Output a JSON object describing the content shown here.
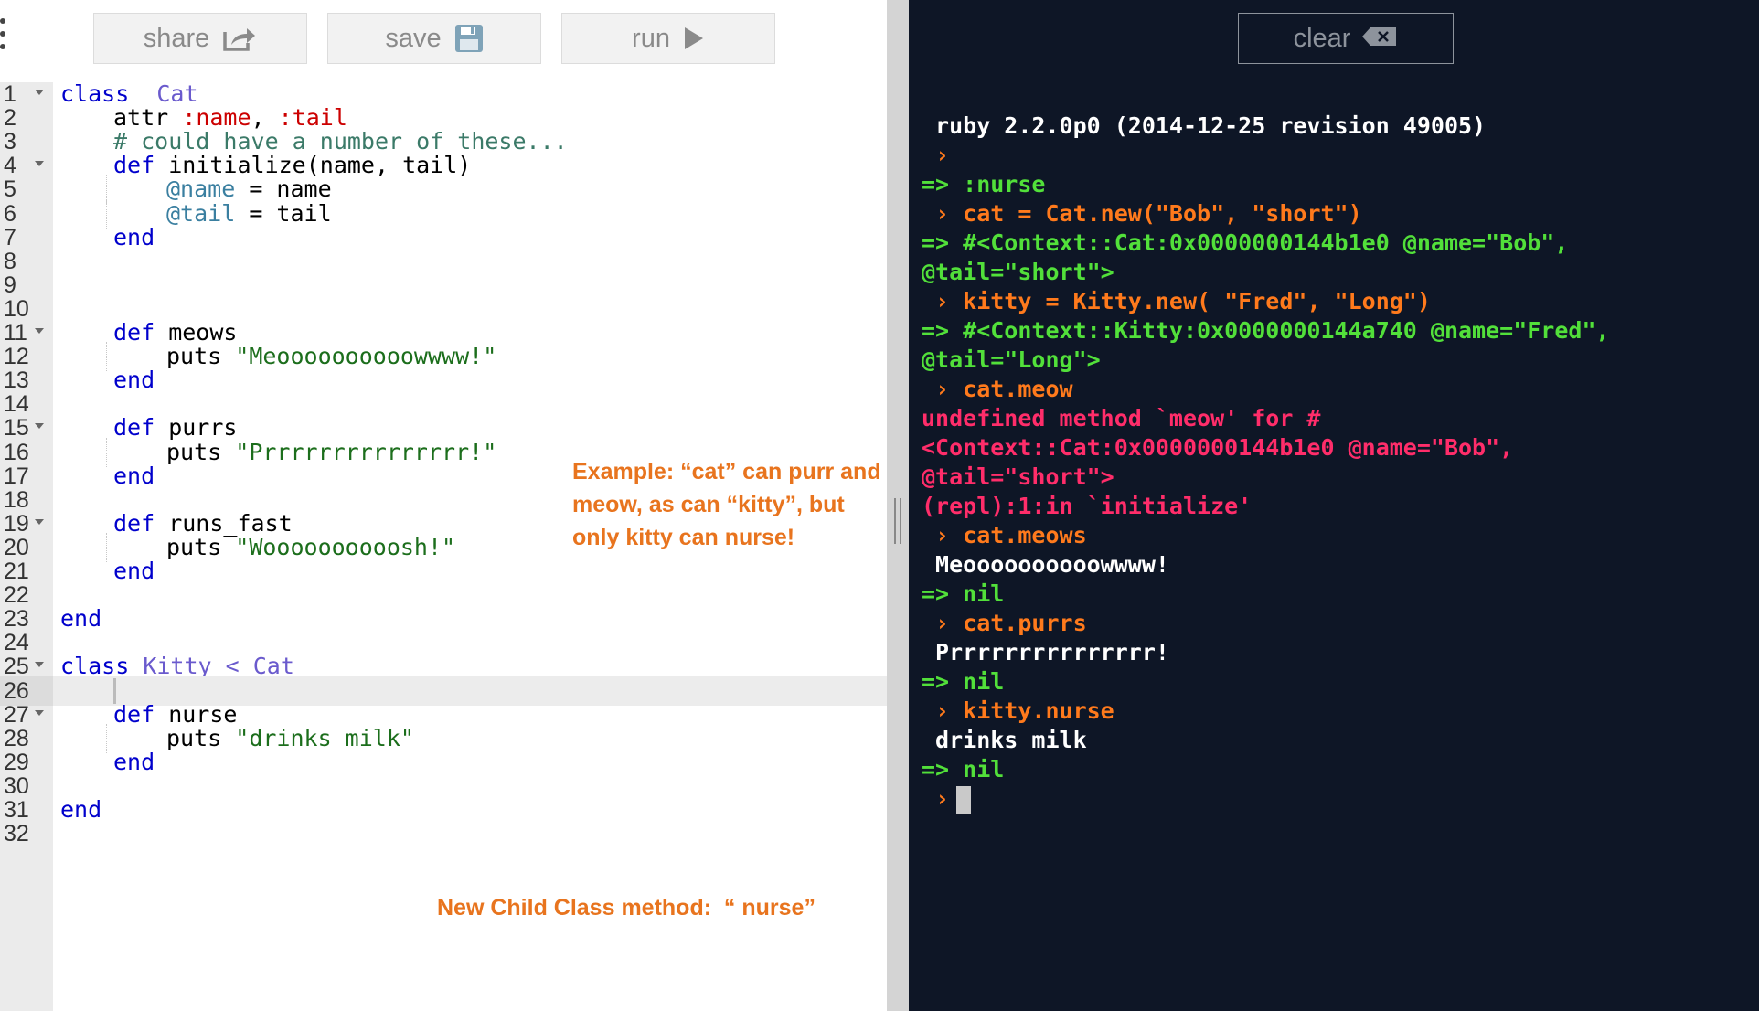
{
  "toolbar": {
    "share_label": "share",
    "save_label": "save",
    "run_label": "run",
    "share_icon": "share-icon",
    "save_icon": "floppy-disk-icon",
    "run_icon": "play-icon"
  },
  "console_toolbar": {
    "clear_label": "clear",
    "clear_icon": "backspace-icon"
  },
  "colors": {
    "console_bg": "#0e1626",
    "accent_orange": "#e8741e",
    "console_green": "#52e03a",
    "console_orange": "#ff7a1c",
    "console_red": "#ff2d6a"
  },
  "editor": {
    "active_line": 26,
    "lines": [
      {
        "n": "1",
        "fold": true,
        "indent": 0,
        "tokens": [
          [
            "kw",
            "class"
          ],
          [
            "",
            "  "
          ],
          [
            "cls",
            "Cat"
          ]
        ]
      },
      {
        "n": "2",
        "fold": false,
        "indent": 1,
        "tokens": [
          [
            "",
            "attr "
          ],
          [
            "sym",
            ":name"
          ],
          [
            "",
            ", "
          ],
          [
            "sym",
            ":tail"
          ]
        ]
      },
      {
        "n": "3",
        "fold": false,
        "indent": 1,
        "tokens": [
          [
            "cm",
            "# could have a number of these..."
          ]
        ]
      },
      {
        "n": "4",
        "fold": true,
        "indent": 1,
        "tokens": [
          [
            "kw",
            "def"
          ],
          [
            "",
            " initialize(name, tail)"
          ]
        ]
      },
      {
        "n": "5",
        "fold": false,
        "indent": 2,
        "tokens": [
          [
            "ivar",
            "@name"
          ],
          [
            "",
            " = name"
          ]
        ]
      },
      {
        "n": "6",
        "fold": false,
        "indent": 2,
        "tokens": [
          [
            "ivar",
            "@tail"
          ],
          [
            "",
            " = tail"
          ]
        ]
      },
      {
        "n": "7",
        "fold": false,
        "indent": 1,
        "tokens": [
          [
            "kw",
            "end"
          ]
        ]
      },
      {
        "n": "8",
        "fold": false,
        "indent": 0,
        "tokens": []
      },
      {
        "n": "9",
        "fold": false,
        "indent": 0,
        "tokens": []
      },
      {
        "n": "10",
        "fold": false,
        "indent": 0,
        "tokens": []
      },
      {
        "n": "11",
        "fold": true,
        "indent": 1,
        "tokens": [
          [
            "kw",
            "def"
          ],
          [
            "",
            " meows"
          ]
        ]
      },
      {
        "n": "12",
        "fold": false,
        "indent": 2,
        "tokens": [
          [
            "",
            "puts "
          ],
          [
            "str",
            "\"Meoooooooooowwww!\""
          ]
        ]
      },
      {
        "n": "13",
        "fold": false,
        "indent": 1,
        "tokens": [
          [
            "kw",
            "end"
          ]
        ]
      },
      {
        "n": "14",
        "fold": false,
        "indent": 0,
        "tokens": []
      },
      {
        "n": "15",
        "fold": true,
        "indent": 1,
        "tokens": [
          [
            "kw",
            "def"
          ],
          [
            "",
            " purrs"
          ]
        ]
      },
      {
        "n": "16",
        "fold": false,
        "indent": 2,
        "tokens": [
          [
            "",
            "puts "
          ],
          [
            "str",
            "\"Prrrrrrrrrrrrrrr!\""
          ]
        ]
      },
      {
        "n": "17",
        "fold": false,
        "indent": 1,
        "tokens": [
          [
            "kw",
            "end"
          ]
        ]
      },
      {
        "n": "18",
        "fold": false,
        "indent": 0,
        "tokens": []
      },
      {
        "n": "19",
        "fold": true,
        "indent": 1,
        "tokens": [
          [
            "kw",
            "def"
          ],
          [
            "",
            " runs_fast"
          ]
        ]
      },
      {
        "n": "20",
        "fold": false,
        "indent": 2,
        "tokens": [
          [
            "",
            "puts "
          ],
          [
            "str",
            "\"Woooooooooosh!\""
          ]
        ]
      },
      {
        "n": "21",
        "fold": false,
        "indent": 1,
        "tokens": [
          [
            "kw",
            "end"
          ]
        ]
      },
      {
        "n": "22",
        "fold": false,
        "indent": 0,
        "tokens": []
      },
      {
        "n": "23",
        "fold": false,
        "indent": 0,
        "tokens": [
          [
            "kw",
            "end"
          ]
        ]
      },
      {
        "n": "24",
        "fold": false,
        "indent": 0,
        "tokens": []
      },
      {
        "n": "25",
        "fold": true,
        "indent": 0,
        "tokens": [
          [
            "kw",
            "class"
          ],
          [
            "",
            " "
          ],
          [
            "cls",
            "Kitty < Cat"
          ]
        ]
      },
      {
        "n": "26",
        "fold": false,
        "indent": 0,
        "tokens": []
      },
      {
        "n": "27",
        "fold": true,
        "indent": 1,
        "tokens": [
          [
            "kw",
            "def"
          ],
          [
            "",
            " nurse"
          ]
        ]
      },
      {
        "n": "28",
        "fold": false,
        "indent": 2,
        "tokens": [
          [
            "",
            "puts "
          ],
          [
            "str",
            "\"drinks milk\""
          ]
        ]
      },
      {
        "n": "29",
        "fold": false,
        "indent": 1,
        "tokens": [
          [
            "kw",
            "end"
          ]
        ]
      },
      {
        "n": "30",
        "fold": false,
        "indent": 0,
        "tokens": []
      },
      {
        "n": "31",
        "fold": false,
        "indent": 0,
        "tokens": [
          [
            "kw",
            "end"
          ]
        ]
      },
      {
        "n": "32",
        "fold": false,
        "indent": 0,
        "tokens": []
      }
    ]
  },
  "annotations": {
    "example_note": "Example: “cat” can purr and meow, as can “kitty”, but only kitty can nurse!",
    "nurse_note": "New Child Class method:  “ nurse”"
  },
  "console": {
    "lines": [
      {
        "t": "output",
        "text": "ruby 2.2.0p0 (2014-12-25 revision 49005)"
      },
      {
        "t": "input",
        "text": ""
      },
      {
        "t": "result",
        "text": "=> :nurse"
      },
      {
        "t": "input",
        "text": "cat = Cat.new(\"Bob\", \"short\")"
      },
      {
        "t": "result",
        "text": "=> #<Context::Cat:0x0000000144b1e0 @name=\"Bob\","
      },
      {
        "t": "result",
        "text": "@tail=\"short\">"
      },
      {
        "t": "input",
        "text": "kitty = Kitty.new( \"Fred\", \"Long\")"
      },
      {
        "t": "result",
        "text": "=> #<Context::Kitty:0x0000000144a740 @name=\"Fred\","
      },
      {
        "t": "result",
        "text": "@tail=\"Long\">"
      },
      {
        "t": "input",
        "text": "cat.meow"
      },
      {
        "t": "error",
        "text": "undefined method `meow' for #"
      },
      {
        "t": "error",
        "text": "<Context::Cat:0x0000000144b1e0 @name=\"Bob\","
      },
      {
        "t": "error",
        "text": "@tail=\"short\">"
      },
      {
        "t": "error",
        "text": "(repl):1:in `initialize'"
      },
      {
        "t": "input",
        "text": "cat.meows"
      },
      {
        "t": "output",
        "text": "Meoooooooooowwww!"
      },
      {
        "t": "result",
        "text": "=> nil"
      },
      {
        "t": "input",
        "text": "cat.purrs"
      },
      {
        "t": "output",
        "text": "Prrrrrrrrrrrrrrr!"
      },
      {
        "t": "result",
        "text": "=> nil"
      },
      {
        "t": "input",
        "text": "kitty.nurse"
      },
      {
        "t": "output",
        "text": "drinks milk"
      },
      {
        "t": "result",
        "text": "=> nil"
      },
      {
        "t": "prompt",
        "text": ""
      }
    ],
    "prompt_symbol": "›"
  }
}
